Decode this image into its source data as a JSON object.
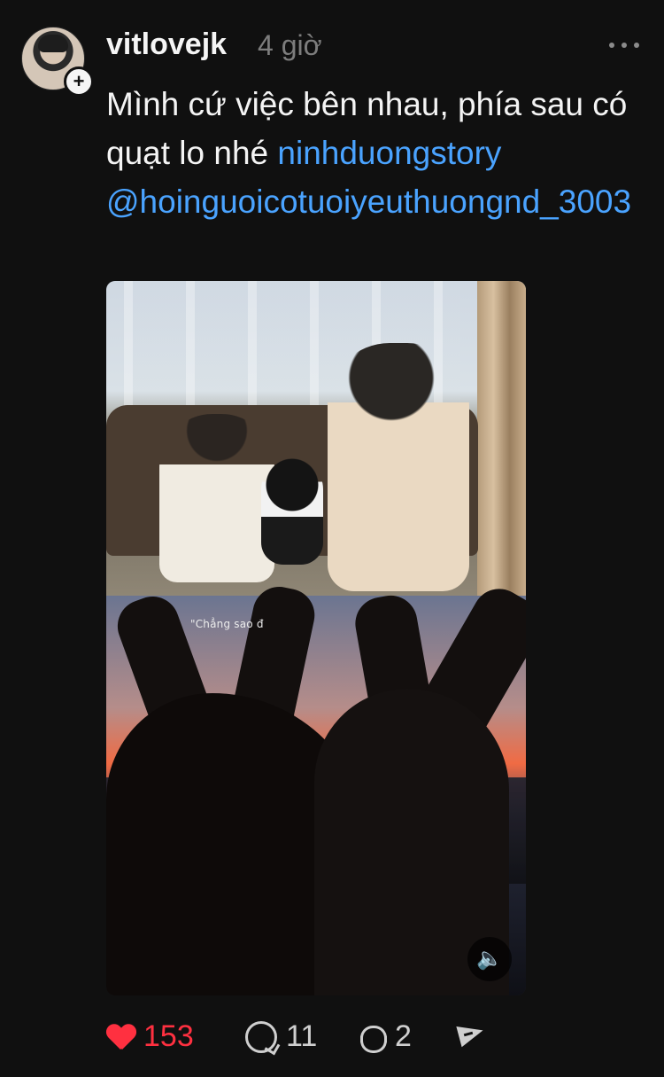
{
  "post": {
    "username": "vitlovejk",
    "time": "4 giờ",
    "caption": {
      "text": "Mình cứ việc bên nhau, phía sau có quạt lo nhé ",
      "tag": "ninhduongstory",
      "mention": "@hoinguoicotuoiyeuthuongnd_3003"
    },
    "media": {
      "overlay_text": "\"Chẳng sao đ"
    },
    "actions": {
      "likes": "153",
      "comments": "11",
      "reposts": "2"
    }
  },
  "icons": {
    "follow": "plus-icon",
    "more": "more-icon",
    "like": "heart-icon",
    "comment": "comment-icon",
    "repost": "repost-icon",
    "share": "send-icon",
    "mute": "speaker-icon"
  },
  "colors": {
    "background": "#101010",
    "text": "#f3f3f3",
    "muted": "#7d7d7d",
    "link": "#4aa3ff",
    "like": "#ff3040"
  }
}
